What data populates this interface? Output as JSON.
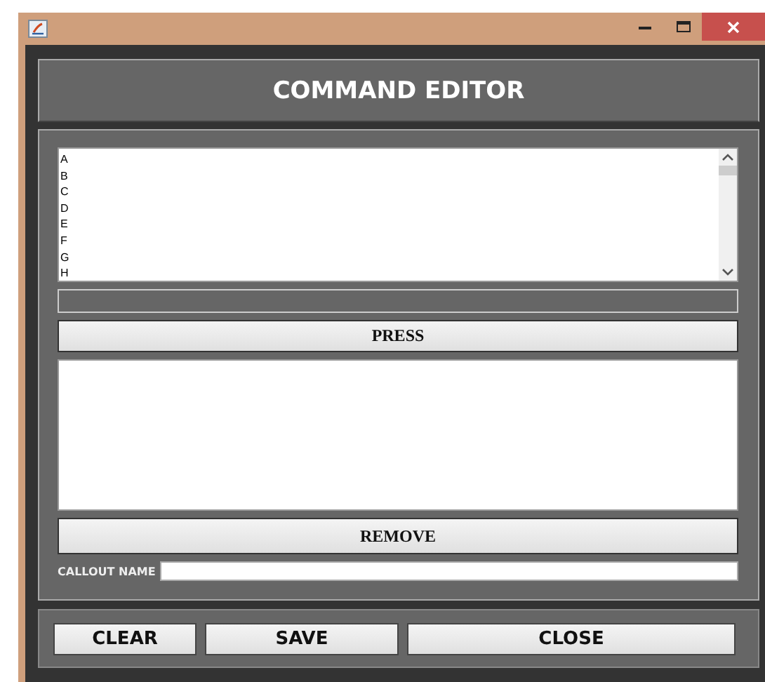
{
  "window": {
    "title": "COMMAND EDITOR"
  },
  "list": {
    "items": [
      "A",
      "B",
      "C",
      "D",
      "E",
      "F",
      "G",
      "H"
    ]
  },
  "press_button": "PRESS",
  "remove_button": "REMOVE",
  "callout": {
    "label": "CALLOUT NAME"
  },
  "buttons": [
    "CLEAR",
    "SAVE",
    "CLOSE"
  ]
}
